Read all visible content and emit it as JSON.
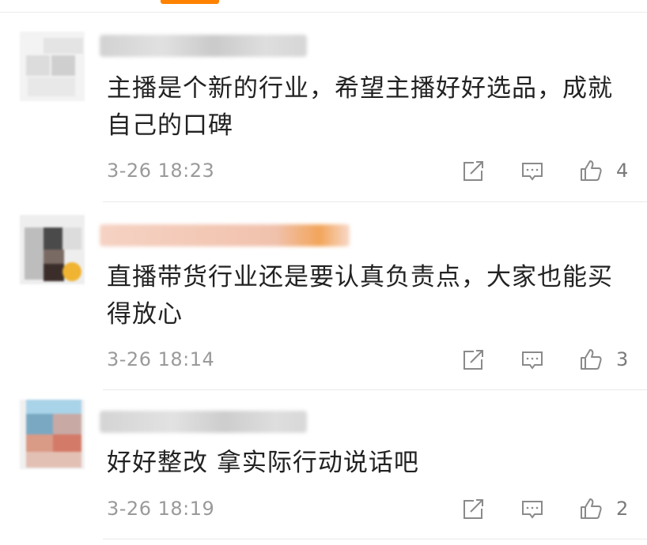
{
  "comments": [
    {
      "text": "主播是个新的行业，希望主播好好选品，成就自己的口碑",
      "time": "3-26 18:23",
      "likes": "4"
    },
    {
      "text": "直播带货行业还是要认真负责点，大家也能买得放心",
      "time": "3-26 18:14",
      "likes": "3"
    },
    {
      "text": "好好整改 拿实际行动说话吧",
      "time": "3-26 18:19",
      "likes": "2"
    }
  ],
  "colors": {
    "accent": "#ff8200",
    "text": "#222222",
    "meta": "#9a9a9a",
    "icon": "#8a8a8a"
  },
  "icons": [
    "share-icon",
    "comment-icon",
    "like-icon"
  ]
}
